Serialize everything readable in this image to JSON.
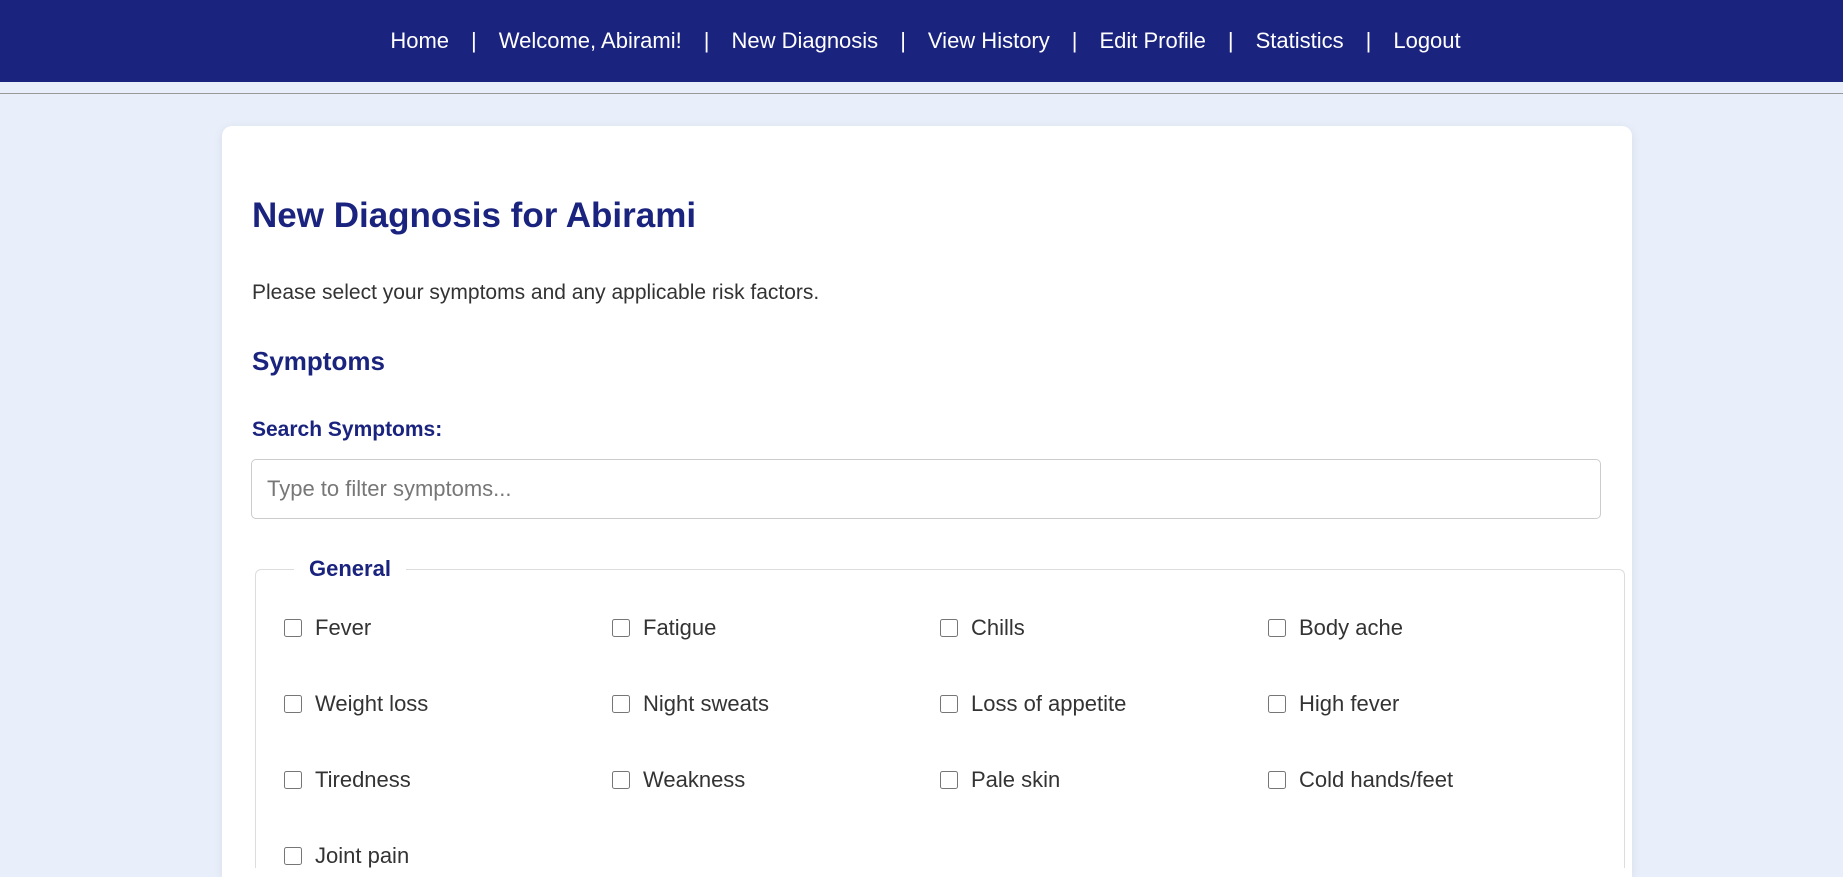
{
  "nav": {
    "items": [
      "Home",
      "Welcome, Abirami!",
      "New Diagnosis",
      "View History",
      "Edit Profile",
      "Statistics",
      "Logout"
    ],
    "separator": "|"
  },
  "main": {
    "title": "New Diagnosis for Abirami",
    "intro": "Please select your symptoms and any applicable risk factors.",
    "section": "Symptoms",
    "search_label": "Search Symptoms:",
    "search_placeholder": "Type to filter symptoms...",
    "search_value": ""
  },
  "general": {
    "legend": "General",
    "symptoms": [
      "Fever",
      "Fatigue",
      "Chills",
      "Body ache",
      "Weight loss",
      "Night sweats",
      "Loss of appetite",
      "High fever",
      "Tiredness",
      "Weakness",
      "Pale skin",
      "Cold hands/feet",
      "Joint pain"
    ]
  }
}
